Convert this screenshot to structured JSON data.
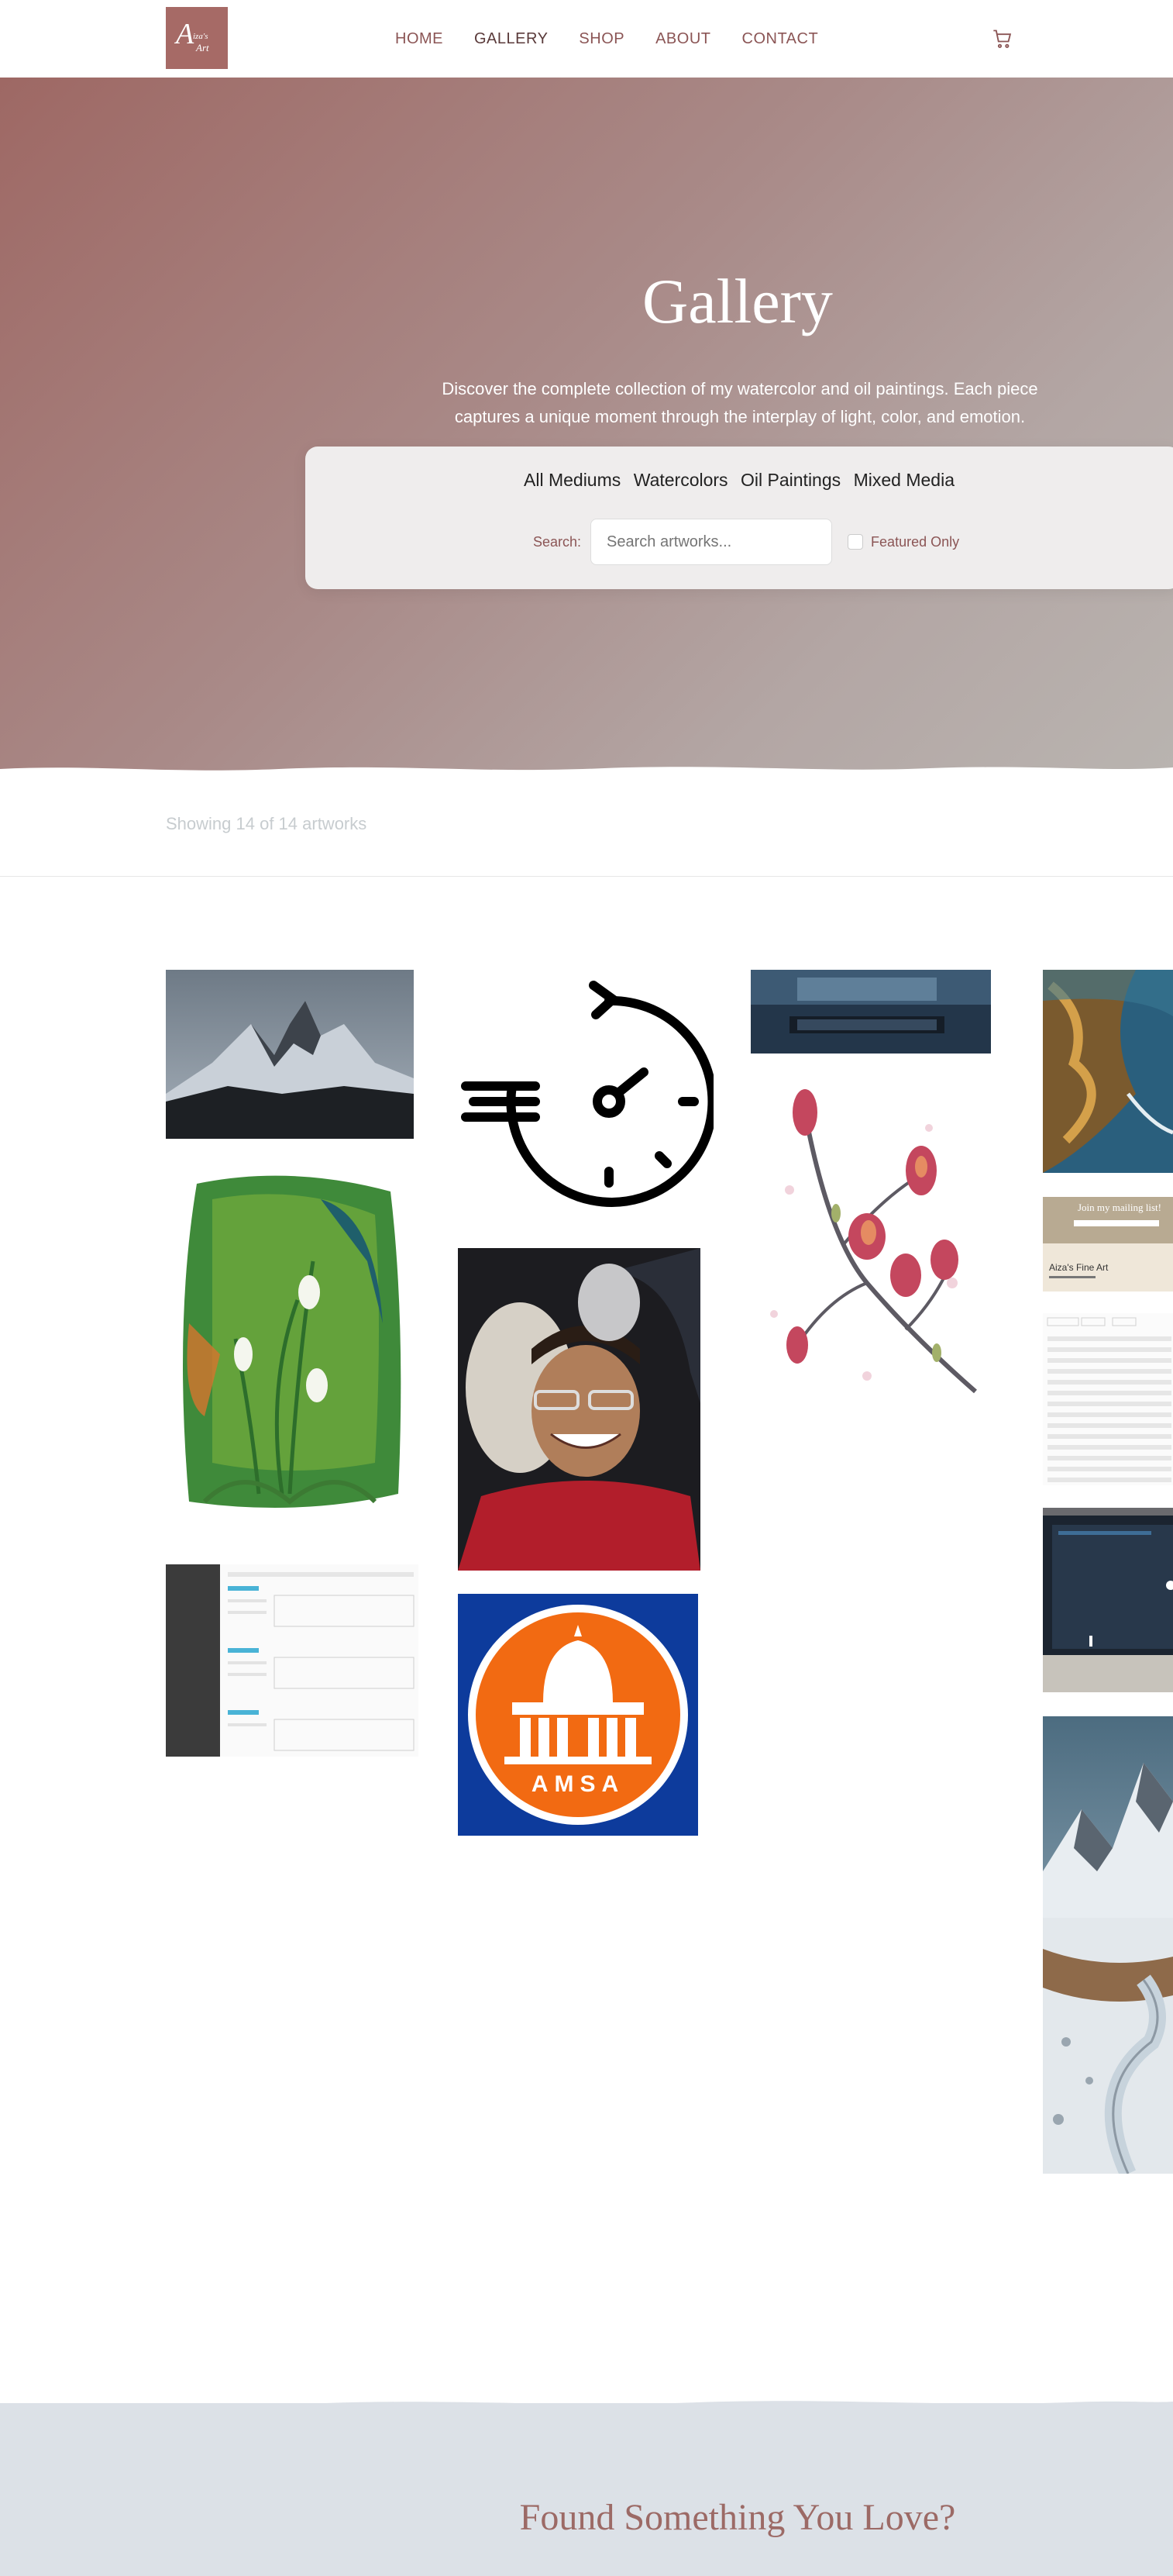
{
  "nav": {
    "logo_text": "Aiza's Art",
    "links": [
      "HOME",
      "GALLERY",
      "SHOP",
      "ABOUT",
      "CONTACT"
    ],
    "active": "GALLERY",
    "cart_icon": "cart-icon"
  },
  "hero": {
    "title": "Gallery",
    "description": "Discover the complete collection of my watercolor and oil paintings. Each piece captures a unique moment through the interplay of light, color, and emotion."
  },
  "filters": {
    "tabs": [
      "All Mediums",
      "Watercolors",
      "Oil Paintings",
      "Mixed Media"
    ],
    "search_label": "Search:",
    "search_placeholder": "Search artworks...",
    "featured_label": "Featured Only",
    "featured_checked": false
  },
  "results": {
    "count_text": "Showing 14 of 14 artworks"
  },
  "artworks": [
    {
      "id": "mountain-peaks",
      "subject": "snowy mountain peaks"
    },
    {
      "id": "speed-timer-icon",
      "subject": "speed timer icon"
    },
    {
      "id": "desk-keyboard",
      "subject": "desk with keyboard"
    },
    {
      "id": "coastal-cliffs",
      "subject": "coastal cliffs"
    },
    {
      "id": "snowdrops-watercolor",
      "subject": "snowdrops watercolor"
    },
    {
      "id": "portrait-man",
      "subject": "portrait of smiling man"
    },
    {
      "id": "magnolia-branch",
      "subject": "magnolia branch watercolor"
    },
    {
      "id": "mailing-list-screenshot",
      "subject": "website screenshot",
      "text": [
        "Join my mailing list!",
        "Aiza's Fine Art"
      ]
    },
    {
      "id": "table-screenshot",
      "subject": "data table screenshot"
    },
    {
      "id": "dashboard-screenshot",
      "subject": "dashboard screenshot"
    },
    {
      "id": "amsa-logo",
      "subject": "AMSA logo",
      "text": [
        "AMSA"
      ]
    },
    {
      "id": "laptop-game",
      "subject": "laptop screen game"
    },
    {
      "id": "snowy-valley-road",
      "subject": "snowy valley road"
    }
  ],
  "cta": {
    "title": "Found Something You Love?"
  },
  "colors": {
    "brand": "#a66a66",
    "nav_text": "#8b5555",
    "cta_bg": "#dce1e7"
  }
}
